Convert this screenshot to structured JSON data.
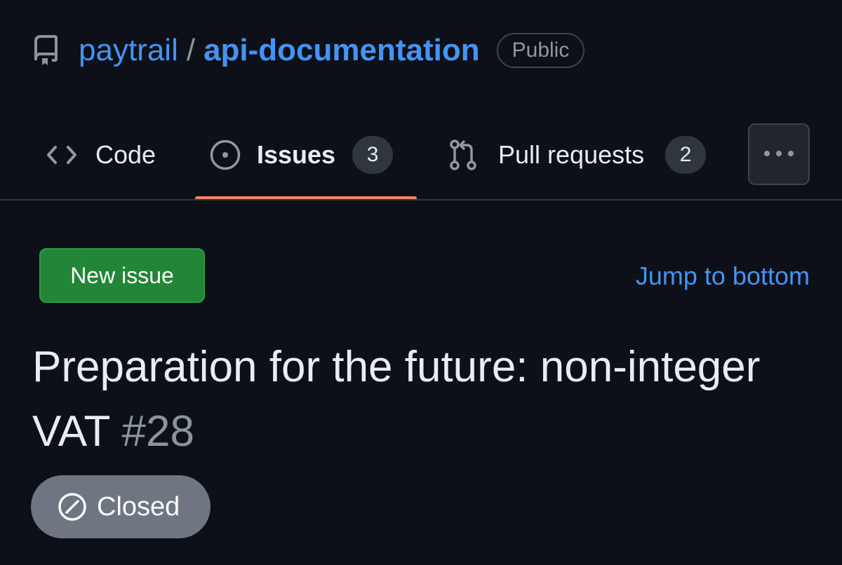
{
  "repo": {
    "owner": "paytrail",
    "separator": "/",
    "name": "api-documentation",
    "visibility": "Public",
    "icon": "repo-icon"
  },
  "tabs": [
    {
      "label": "Code",
      "icon": "code-icon"
    },
    {
      "label": "Issues",
      "count": "3",
      "icon": "issue-opened-icon",
      "selected": true
    },
    {
      "label": "Pull requests",
      "count": "2",
      "icon": "pull-request-icon"
    }
  ],
  "more_icon": "kebab-horizontal-icon",
  "actions": {
    "new_issue": "New issue",
    "jump_to_bottom": "Jump to bottom"
  },
  "issue": {
    "title": "Preparation for the future: non-integer VAT",
    "number": "#28",
    "state": "Closed",
    "state_icon": "skip-icon"
  },
  "colors": {
    "background": "#0d1117",
    "link": "#4493f8",
    "primary_button": "#238636",
    "selected_tab_underline": "#f78166",
    "closed_badge": "#6e7681"
  }
}
